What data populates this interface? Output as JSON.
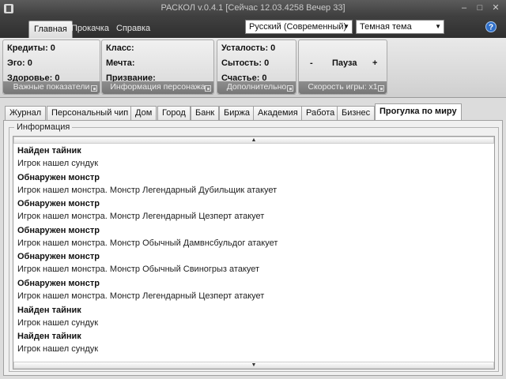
{
  "window": {
    "title": "РАСКОЛ v.0.4.1 [Сейчас 12.03.4258 Вечер 33]",
    "controls": {
      "minimize": "–",
      "maximize": "□",
      "close": "✕"
    }
  },
  "ribbon": {
    "tabs": [
      "Главная",
      "Прокачка",
      "Справка"
    ],
    "active_tab": "Главная",
    "language": "Русский (Современный)",
    "theme": "Темная тема"
  },
  "groups": {
    "main_stats": {
      "rows": [
        "Кредиты: 0",
        "Эго: 0",
        "Здоровье: 0"
      ],
      "caption": "Важные показатели"
    },
    "character": {
      "rows": [
        "Класс:",
        "Мечта:",
        "Призвание:"
      ],
      "caption": "Информация персонажа"
    },
    "extra": {
      "rows": [
        "Усталость: 0",
        "Сытость: 0",
        "Счастье: 0"
      ],
      "caption": "Дополнительно"
    },
    "speed": {
      "minus": "-",
      "pause": "Пауза",
      "plus": "+",
      "caption": "Скорость игры: x1"
    }
  },
  "page_tabs": [
    "Журнал",
    "Персональный чип",
    "Дом",
    "Город",
    "Банк",
    "Биржа",
    "Академия",
    "Работа",
    "Бизнес",
    "Прогулка по миру"
  ],
  "active_page_tab": "Прогулка по миру",
  "info": {
    "title": "Информация",
    "log": [
      {
        "head": "Найден тайник",
        "body": "Игрок нашел сундук"
      },
      {
        "head": "Обнаружен монстр",
        "body": "Игрок нашел монстра. Монстр Легендарный Дубильщик атакует"
      },
      {
        "head": "Обнаружен монстр",
        "body": "Игрок нашел монстра. Монстр Легендарный Цезперт атакует"
      },
      {
        "head": "Обнаружен монстр",
        "body": "Игрок нашел монстра. Монстр Обычный Дамвнсбульдог атакует"
      },
      {
        "head": "Обнаружен монстр",
        "body": "Игрок нашел монстра. Монстр Обычный Свиногрыз атакует"
      },
      {
        "head": "Обнаружен монстр",
        "body": "Игрок нашел монстра. Монстр Легендарный Цезперт атакует"
      },
      {
        "head": "Найден тайник",
        "body": "Игрок нашел сундук"
      },
      {
        "head": "Найден тайник",
        "body": "Игрок нашел сундук"
      }
    ]
  },
  "colors": {
    "dark_chrome": "#3d3d3d",
    "ribbon": "#dcdcdc",
    "caption": "#7d7d7d"
  },
  "icons": [
    "app-icon",
    "help-icon",
    "dialog-launcher-icon",
    "scroll-up-arrow",
    "scroll-down-arrow",
    "dropdown-arrow"
  ]
}
